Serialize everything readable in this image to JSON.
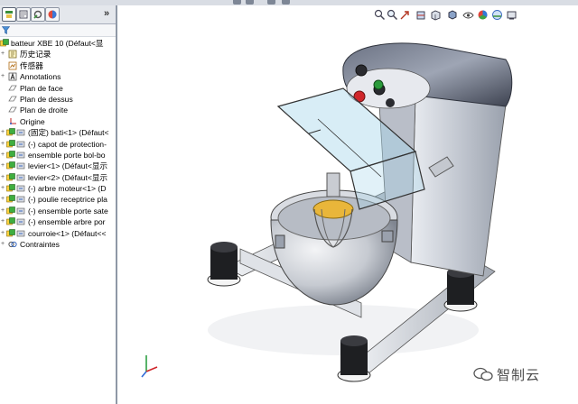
{
  "app": {
    "title": "SolidWorks feature manager — batteur XBE 10"
  },
  "panel": {
    "tabs": [
      "feature-manager",
      "property-manager",
      "configuration-manager",
      "display-manager"
    ],
    "expand_glyph": "»",
    "filter_icon": "funnel-icon"
  },
  "tree": {
    "root": {
      "label": "batteur XBE 10  (Défaut<显"
    },
    "items": [
      {
        "label": "历史记录",
        "icon": "history-icon"
      },
      {
        "label": "传感器",
        "icon": "sensor-icon"
      },
      {
        "label": "Annotations",
        "icon": "annotations-icon"
      },
      {
        "label": "Plan de face",
        "icon": "plane-icon"
      },
      {
        "label": "Plan de dessus",
        "icon": "plane-icon"
      },
      {
        "label": "Plan de droite",
        "icon": "plane-icon"
      },
      {
        "label": "Origine",
        "icon": "origin-icon"
      },
      {
        "label": "(固定) bati<1> (Défaut<",
        "icon": "part-icon"
      },
      {
        "label": "(-) capot de protection-",
        "icon": "part-icon"
      },
      {
        "label": "ensemble porte bol-bo",
        "icon": "part-icon"
      },
      {
        "label": "levier<1> (Défaut<显示",
        "icon": "part-icon"
      },
      {
        "label": "levier<2> (Défaut<显示",
        "icon": "part-icon"
      },
      {
        "label": "(-) arbre moteur<1> (D",
        "icon": "part-icon"
      },
      {
        "label": "(-) poulie receptrice pla",
        "icon": "part-icon"
      },
      {
        "label": "(-) ensemble porte sate",
        "icon": "part-icon"
      },
      {
        "label": "(-) ensemble arbre por",
        "icon": "part-icon"
      },
      {
        "label": "courroie<1> (Défaut<<",
        "icon": "part-icon"
      },
      {
        "label": "Contraintes",
        "icon": "mates-icon"
      }
    ]
  },
  "view_toolbar": {
    "icons": [
      "zoom-to-fit-icon",
      "zoom-area-icon",
      "previous-view-icon",
      "section-view-icon",
      "view-orientation-icon",
      "display-style-icon",
      "hide-show-icon",
      "edit-appearance-icon",
      "scene-icon",
      "view-settings-icon"
    ]
  },
  "watermark": {
    "text": "智制云"
  },
  "colors": {
    "body_metal": "#cfd3da",
    "cap_dark": "#4b5160",
    "guard_blue": "#a8d6ec",
    "whisk_gold": "#e9b63a",
    "leg_black": "#1e1f22",
    "button_red": "#d0262b",
    "button_green": "#2a9b3a"
  }
}
